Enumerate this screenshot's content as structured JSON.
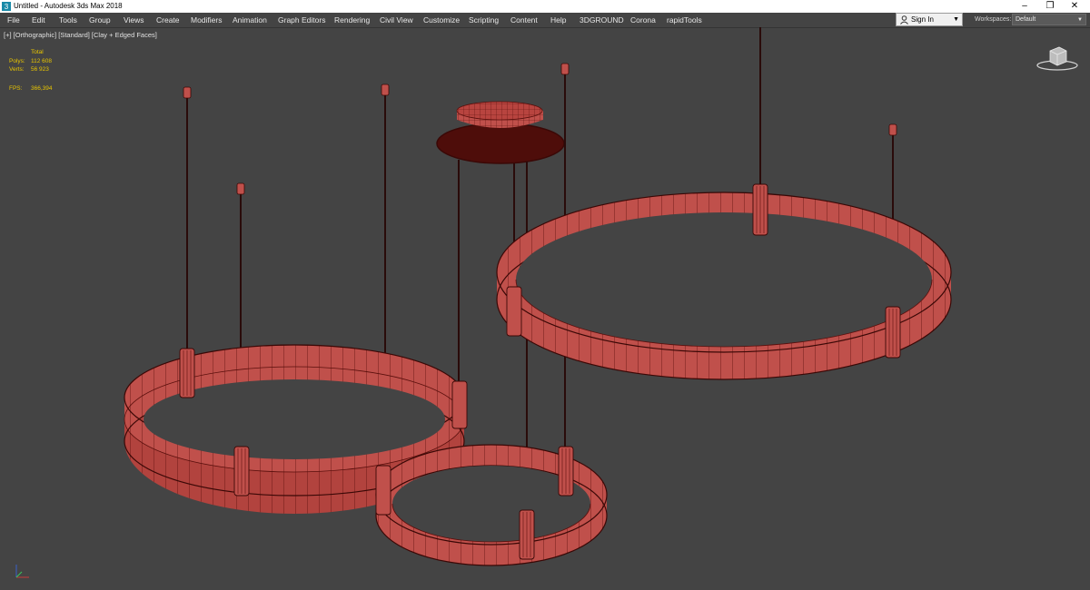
{
  "window": {
    "title": "Untitled - Autodesk 3ds Max 2018",
    "controls": {
      "minimize": "–",
      "restore": "❐",
      "close": "✕"
    }
  },
  "menu": {
    "items": [
      "File",
      "Edit",
      "Tools",
      "Group",
      "Views",
      "Create",
      "Modifiers",
      "Animation",
      "Graph Editors",
      "Rendering",
      "Civil View",
      "Customize",
      "Scripting",
      "Content",
      "Help",
      "3DGROUND",
      "Corona",
      "rapidTools"
    ]
  },
  "signin": {
    "label": "Sign In"
  },
  "workspaces": {
    "label": "Workspaces:",
    "value": "Default"
  },
  "viewport": {
    "label": "[+] [Orthographic] [Standard] [Clay + Edged Faces]",
    "stats": {
      "header": "Total",
      "polys_label": "Polys:",
      "polys_value": "112 608",
      "verts_label": "Verts:",
      "verts_value": "56 923",
      "fps_label": "FPS:",
      "fps_value": "366,394"
    }
  },
  "colors": {
    "background": "#444444",
    "mesh_fill": "#c0504b",
    "mesh_wire": "#5a0f0c",
    "stats_text": "#e8c500"
  }
}
